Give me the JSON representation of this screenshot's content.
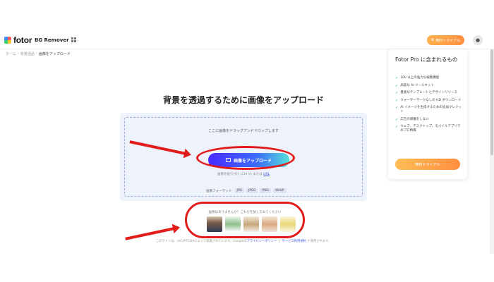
{
  "header": {
    "logo_text": "fotor",
    "product_name": "BG Remover",
    "trial_button": "無料トライアル",
    "avatar_icon": "user-avatar"
  },
  "breadcrumb": {
    "items": [
      "ホーム",
      "背景透過",
      "画像をアップロード"
    ]
  },
  "main": {
    "title": "背景を透過するために画像をアップロード",
    "drop_text": "ここに画像をドラッグアンドドロップします",
    "upload_button": "画像をアップロード",
    "paste_hint_prefix": "画像を貼り付け (Ctrl V) または ",
    "paste_hint_link": "URL",
    "formats_label": "画像フォーマット:",
    "formats": [
      "JPG",
      "JPEG",
      "PNG",
      "WebP"
    ],
    "samples_label": "画像はありませんか？これらを試してみてください",
    "footer_prefix": "このサイトは、reCAPTCHAによって保護されています。Googleの",
    "footer_link1": "プライバシーポリシー",
    "footer_mid": " と ",
    "footer_link2": "サービス利用規約",
    "footer_suffix": " が適用されます。"
  },
  "pro_card": {
    "title": "Fotor Pro に含まれるもの",
    "features": [
      "100 以上の強力な編集機能",
      "高度な AI ツールキット",
      "豊富なテンプレートとデザインリソース",
      "ウォーターマークなしの HD ダウンロード",
      "AI イメージを生成するための追加クレジット",
      "広告の邪魔をしない",
      "ウェブ、デスクトップ、モバイルアプリでのプロ特典"
    ],
    "button": "無料トライアル"
  },
  "colors": {
    "annotation_red": "#e21b1b",
    "upload_gradient_start": "#4a2bff",
    "upload_gradient_end": "#55e0d6",
    "trial_orange": "#ff8f3f"
  }
}
